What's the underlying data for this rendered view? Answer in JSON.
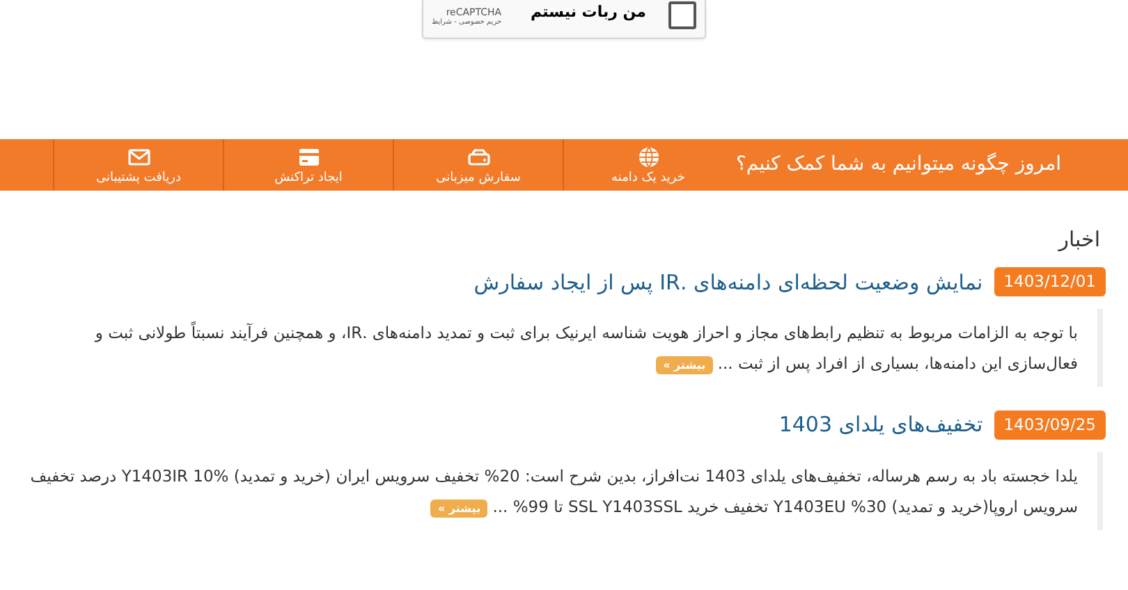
{
  "captcha": {
    "label": "من ربات نیستم",
    "checked": false,
    "brand": "reCAPTCHA",
    "links": "حریم خصوصی - شرایط"
  },
  "help_bar": {
    "question": "امروز چگونه میتوانیم به شما کمک کنیم؟",
    "actions": [
      {
        "kind": "globe",
        "label": "خرید یک دامنه"
      },
      {
        "kind": "server",
        "label": "سفارش میزبانی"
      },
      {
        "kind": "card",
        "label": "ایجاد تراکنش"
      },
      {
        "kind": "envelope",
        "label": "دریافت پشتیبانی"
      }
    ]
  },
  "news": {
    "heading": "اخبار",
    "items": [
      {
        "date": "1403/12/01",
        "title": "نمایش وضعیت لحظه‌ای دامنه‌های .IR پس از ایجاد سفارش",
        "summary": "با توجه به الزامات مربوط به تنظیم رابط‌های مجاز و احراز هویت شناسه ایرنیک برای ثبت و تمدید دامنه‌های .IR، و همچنین فرآیند نسبتاً طولانی ثبت و فعال‌سازی این دامنه‌ها، بسیاری از افراد پس از ثبت ...",
        "more": "بیشتر »"
      },
      {
        "date": "1403/09/25",
        "title": "تخفیف‌های یلدای 1403",
        "summary": "یلدا خجسته باد به رسم هرساله، تخفیف‌های یلدای 1403 نت‌افراز، بدین شرح است:  20% تخفیف سرویس ایران (خرید و تمدید) Y1403IR 10% درصد تخفیف سرویس اروپا(خرید و تمدید) 30%  Y1403EU تخفیف خرید SSL Y1403SSL  تا 99% ...",
        "more": "بیشتر »"
      }
    ]
  }
}
